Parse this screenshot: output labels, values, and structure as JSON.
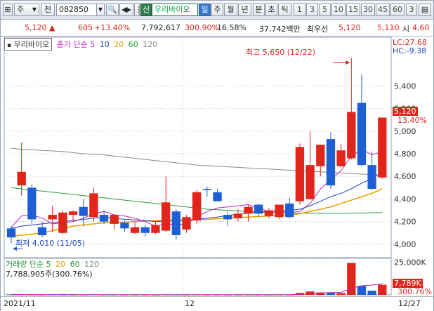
{
  "toolbar": {
    "market_sel": "주",
    "type_sel": "전",
    "code": "082850",
    "badge": "신",
    "name": "우리바이오",
    "periods": [
      "일",
      "주",
      "월",
      "년",
      "분",
      "초",
      "틱"
    ],
    "numbers": [
      "1",
      "3",
      "5",
      "10",
      "15",
      "30",
      "45",
      "60",
      "3"
    ]
  },
  "quote": {
    "price": "5,120",
    "change": "605",
    "change_pct": "+13.40%",
    "volume": "7,792,617",
    "vol_ratio": "300.90%",
    "turnover": "16.58%",
    "amount": "37,742백만",
    "best_ask_label": "최우선",
    "ask": "5,120",
    "bid": "5,110",
    "open_label": "시",
    "open": "4,60"
  },
  "price_legend": {
    "name": "우리바이오",
    "ma_label": "종가 단순 5",
    "ma_periods": [
      "10",
      "20",
      "60",
      "120"
    ]
  },
  "vol_legend": {
    "label": "거래량 단순 5",
    "ma_periods": [
      "20",
      "60",
      "120"
    ],
    "value": "7,788,905주(300.76%)"
  },
  "annotations": {
    "high": "최고 5,650 (12/22)",
    "low": "최저 4,010 (11/05)",
    "lc": "LC:27.68",
    "hc": "HC:-9.38",
    "current_price": "5,120",
    "current_pct": "13.40%",
    "vol_current": "7,789K",
    "vol_pct": "300.76%"
  },
  "x_labels": [
    "2021/11",
    "12",
    "12/27"
  ],
  "colors": {
    "up": "#e1251b",
    "down": "#1f5fd6",
    "ma5": "#c020c0",
    "ma10": "#1a3fc0",
    "ma20": "#e8a200",
    "ma60": "#2a9a3a",
    "ma120": "#8a8a8a"
  },
  "chart_data": [
    {
      "type": "candlestick",
      "ylim": [
        3900,
        5750
      ],
      "y_ticks": [
        "4,000",
        "4,200",
        "4,400",
        "4,600",
        "4,800",
        "5,000",
        "5,200",
        "5,400"
      ],
      "candles": [
        {
          "o": 4140,
          "h": 4160,
          "l": 4010,
          "c": 4060
        },
        {
          "o": 4520,
          "h": 4900,
          "l": 4430,
          "c": 4640
        },
        {
          "o": 4500,
          "h": 4530,
          "l": 4180,
          "c": 4220
        },
        {
          "o": 4150,
          "h": 4200,
          "l": 4060,
          "c": 4080
        },
        {
          "o": 4220,
          "h": 4340,
          "l": 4110,
          "c": 4260
        },
        {
          "o": 4100,
          "h": 4300,
          "l": 4090,
          "c": 4280
        },
        {
          "o": 4260,
          "h": 4300,
          "l": 4210,
          "c": 4290
        },
        {
          "o": 4330,
          "h": 4400,
          "l": 4160,
          "c": 4250
        },
        {
          "o": 4240,
          "h": 4500,
          "l": 4200,
          "c": 4450
        },
        {
          "o": 4260,
          "h": 4300,
          "l": 4180,
          "c": 4200
        },
        {
          "o": 4180,
          "h": 4250,
          "l": 4130,
          "c": 4260
        },
        {
          "o": 4190,
          "h": 4210,
          "l": 4110,
          "c": 4140
        },
        {
          "o": 4100,
          "h": 4200,
          "l": 4090,
          "c": 4150
        },
        {
          "o": 4150,
          "h": 4170,
          "l": 4070,
          "c": 4100
        },
        {
          "o": 4100,
          "h": 4200,
          "l": 4090,
          "c": 4170
        },
        {
          "o": 4120,
          "h": 4600,
          "l": 4110,
          "c": 4370
        },
        {
          "o": 4290,
          "h": 4310,
          "l": 4040,
          "c": 4080
        },
        {
          "o": 4130,
          "h": 4260,
          "l": 4100,
          "c": 4240
        },
        {
          "o": 4210,
          "h": 4480,
          "l": 4180,
          "c": 4460
        },
        {
          "o": 4490,
          "h": 4510,
          "l": 4420,
          "c": 4480
        },
        {
          "o": 4460,
          "h": 4490,
          "l": 4380,
          "c": 4380
        },
        {
          "o": 4260,
          "h": 4290,
          "l": 4160,
          "c": 4220
        },
        {
          "o": 4230,
          "h": 4310,
          "l": 4200,
          "c": 4270
        },
        {
          "o": 4270,
          "h": 4350,
          "l": 4200,
          "c": 4330
        },
        {
          "o": 4350,
          "h": 4360,
          "l": 4240,
          "c": 4270
        },
        {
          "o": 4250,
          "h": 4320,
          "l": 4230,
          "c": 4300
        },
        {
          "o": 4240,
          "h": 4350,
          "l": 4220,
          "c": 4350
        },
        {
          "o": 4360,
          "h": 4410,
          "l": 4230,
          "c": 4240
        },
        {
          "o": 4380,
          "h": 4890,
          "l": 4350,
          "c": 4860
        },
        {
          "o": 4400,
          "h": 5000,
          "l": 4390,
          "c": 4700
        },
        {
          "o": 4690,
          "h": 4880,
          "l": 4600,
          "c": 4880
        },
        {
          "o": 4930,
          "h": 4990,
          "l": 4490,
          "c": 4520
        },
        {
          "o": 4690,
          "h": 4890,
          "l": 4680,
          "c": 4830
        },
        {
          "o": 4760,
          "h": 5650,
          "l": 4750,
          "c": 5170
        },
        {
          "o": 5250,
          "h": 5500,
          "l": 4690,
          "c": 4700
        },
        {
          "o": 4700,
          "h": 4820,
          "l": 4480,
          "c": 4490
        },
        {
          "o": 4590,
          "h": 5120,
          "l": 4580,
          "c": 5120
        }
      ],
      "ma5": [
        4150,
        4250,
        4260,
        4230,
        4180,
        4190,
        4200,
        4230,
        4270,
        4290,
        4260,
        4250,
        4230,
        4200,
        4160,
        4180,
        4170,
        4180,
        4240,
        4290,
        4320,
        4330,
        4340,
        4350,
        4320,
        4290,
        4290,
        4280,
        4290,
        4360,
        4490,
        4570,
        4650,
        4780,
        4840,
        4790,
        4820
      ],
      "ma10": [
        4140,
        4160,
        4170,
        4180,
        4190,
        4200,
        4210,
        4220,
        4230,
        4240,
        4230,
        4220,
        4215,
        4210,
        4200,
        4205,
        4210,
        4215,
        4220,
        4230,
        4240,
        4255,
        4265,
        4275,
        4285,
        4290,
        4295,
        4300,
        4310,
        4340,
        4380,
        4420,
        4450,
        4490,
        4540,
        4580,
        4640
      ],
      "ma20": [
        4070,
        4080,
        4090,
        4100,
        4120,
        4140,
        4160,
        4170,
        4180,
        4190,
        4190,
        4195,
        4200,
        4205,
        4210,
        4210,
        4212,
        4215,
        4218,
        4220,
        4225,
        4230,
        4235,
        4240,
        4245,
        4250,
        4255,
        4260,
        4270,
        4290,
        4310,
        4330,
        4360,
        4390,
        4420,
        4450,
        4490
      ],
      "ma60": [
        4500,
        4490,
        4480,
        4470,
        4460,
        4450,
        4440,
        4430,
        4420,
        4410,
        4400,
        4390,
        4380,
        4370,
        4360,
        4350,
        4340,
        4330,
        4320,
        4310,
        4305,
        4300,
        4295,
        4290,
        4285,
        4280,
        4278,
        4276,
        4275,
        4274,
        4273,
        4273,
        4274,
        4275,
        4276,
        4278,
        4280
      ],
      "ma120": [
        4850,
        4840,
        4835,
        4830,
        4825,
        4820,
        4810,
        4800,
        4795,
        4790,
        4780,
        4770,
        4760,
        4750,
        4740,
        4730,
        4720,
        4710,
        4700,
        4695,
        4690,
        4685,
        4680,
        4675,
        4670,
        4665,
        4660,
        4655,
        4650,
        4645,
        4640,
        4635,
        4630,
        4625,
        4620,
        4615,
        4610
      ]
    },
    {
      "type": "bar",
      "ylim": [
        0,
        27000
      ],
      "y_ticks": [
        "25,000K"
      ],
      "values": [
        300,
        250,
        200,
        180,
        220,
        190,
        170,
        160,
        240,
        150,
        140,
        130,
        120,
        110,
        100,
        180,
        160,
        120,
        200,
        150,
        130,
        110,
        100,
        120,
        110,
        100,
        150,
        140,
        1500,
        2600,
        1800,
        1600,
        1400,
        24500,
        7000,
        3200,
        7789
      ],
      "ma5": [
        250,
        240,
        230,
        220,
        210,
        200,
        190,
        180,
        190,
        180,
        170,
        160,
        150,
        140,
        130,
        140,
        140,
        130,
        150,
        150,
        140,
        130,
        120,
        120,
        115,
        110,
        120,
        130,
        400,
        900,
        1400,
        1800,
        1900,
        5000,
        7000,
        7500,
        8400
      ]
    }
  ]
}
